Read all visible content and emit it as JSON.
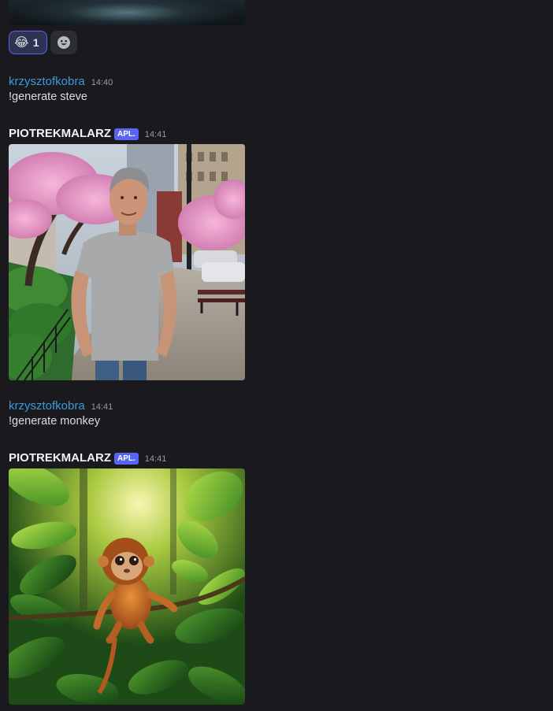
{
  "top_message": {
    "reactions": [
      {
        "emoji": "😂",
        "count": "1",
        "emoji_name": "joy-emoji"
      },
      {
        "emoji_name": "add-reaction-icon"
      }
    ]
  },
  "messages": [
    {
      "username": "krzysztofkobra",
      "timestamp": "14:40",
      "text": "!generate steve",
      "color": "#3a9ad9"
    },
    {
      "username": "PIOTREKMALARZ",
      "badge": "APL.",
      "timestamp": "14:41",
      "image": "generated-image-steve"
    },
    {
      "username": "krzysztofkobra",
      "timestamp": "14:41",
      "text": "!generate monkey",
      "color": "#3a9ad9"
    },
    {
      "username": "PIOTREKMALARZ",
      "badge": "APL.",
      "timestamp": "14:41",
      "image": "generated-image-monkey"
    }
  ],
  "colors": {
    "background": "#1a1a1e",
    "brand": "#5865f2",
    "user_name": "#3a9ad9"
  }
}
